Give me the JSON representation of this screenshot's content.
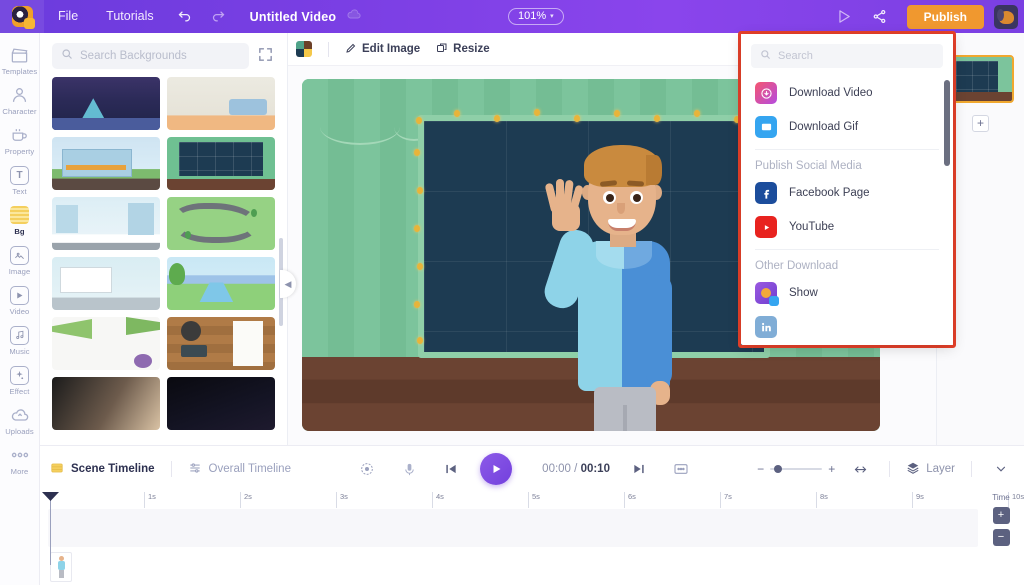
{
  "topbar": {
    "logo_icon": "animaker-logo-icon",
    "menus": [
      "File",
      "Tutorials"
    ],
    "undo_icon": "undo-icon",
    "redo_icon": "redo-icon",
    "doc_title": "Untitled Video",
    "cloud_icon": "cloud-save-icon",
    "zoom_level": "101%",
    "zoom_caret": "▾",
    "preview_icon": "preview-play-icon",
    "share_icon": "share-icon",
    "publish_label": "Publish",
    "avatar_icon": "user-avatar",
    "accent_purple": "#7b3fe4",
    "publish_orange": "#f0982f"
  },
  "rail": {
    "items": [
      {
        "label": "Templates",
        "icon": "templates-icon",
        "active": false
      },
      {
        "label": "Character",
        "icon": "character-icon",
        "active": false
      },
      {
        "label": "Property",
        "icon": "property-icon",
        "active": false
      },
      {
        "label": "Text",
        "icon": "text-icon",
        "active": false
      },
      {
        "label": "Bg",
        "icon": "background-icon",
        "active": true
      },
      {
        "label": "Image",
        "icon": "image-icon",
        "active": false
      },
      {
        "label": "Video",
        "icon": "video-icon",
        "active": false
      },
      {
        "label": "Music",
        "icon": "music-icon",
        "active": false
      },
      {
        "label": "Effect",
        "icon": "effect-icon",
        "active": false
      },
      {
        "label": "Uploads",
        "icon": "uploads-icon",
        "active": false
      },
      {
        "label": "More",
        "icon": "more-icon",
        "active": false
      }
    ]
  },
  "bg_panel": {
    "search_placeholder": "Search Backgrounds",
    "search_value": "",
    "search_icon": "search-icon",
    "expand_icon": "expand-icon",
    "collapse_icon": "chevron-left-icon",
    "thumbnails": [
      {
        "name": "night-cave-scene"
      },
      {
        "name": "living-room-sofa-scene"
      },
      {
        "name": "office-building-exterior"
      },
      {
        "name": "classroom-chalkboard-scene"
      },
      {
        "name": "city-street-winter"
      },
      {
        "name": "winding-road-landscape"
      },
      {
        "name": "presentation-screen-room"
      },
      {
        "name": "river-mountain-landscape"
      },
      {
        "name": "palm-leaves-flatlay"
      },
      {
        "name": "wooden-desk-flatlay"
      },
      {
        "name": "blurred-warm-photo"
      },
      {
        "name": "dark-photo"
      }
    ]
  },
  "canvas": {
    "swatch_icon": "color-swatch-icon",
    "edit_image_label": "Edit Image",
    "edit_image_icon": "pencil-icon",
    "resize_label": "Resize",
    "resize_icon": "resize-icon",
    "scene_name": "classroom-chalkboard-scene",
    "character_name": "waving-boy-character"
  },
  "scenes_panel": {
    "selected_scene": "scene-1-classroom",
    "add_scene_label": "+",
    "selection_color": "#f0a82f"
  },
  "publish_dropdown": {
    "highlight_color": "#e8412a",
    "search_placeholder": "Search",
    "search_value": "",
    "search_icon": "search-icon",
    "items": [
      {
        "label": "Download Video",
        "icon": "download-video-icon"
      },
      {
        "label": "Download Gif",
        "icon": "download-gif-icon"
      }
    ],
    "section_social": "Publish Social Media",
    "social_items": [
      {
        "label": "Facebook Page",
        "icon": "facebook-icon"
      },
      {
        "label": "YouTube",
        "icon": "youtube-icon"
      }
    ],
    "section_other": "Other Download",
    "other_items": [
      {
        "label": "Show",
        "icon": "show-app-icon"
      },
      {
        "label": "",
        "icon": "linkedin-icon"
      }
    ]
  },
  "timeline": {
    "scene_tab": "Scene Timeline",
    "scene_tab_icon": "scene-timeline-icon",
    "overall_tab": "Overall Timeline",
    "overall_tab_icon": "overall-timeline-icon",
    "transition_icon": "transition-icon",
    "mic_icon": "microphone-icon",
    "prev_icon": "previous-scene-icon",
    "play_icon": "play-icon",
    "next_icon": "next-scene-icon",
    "caption_icon": "caption-icon",
    "current_time": "00:00",
    "time_separator": "/",
    "total_time": "00:10",
    "zoom_minus": "−",
    "zoom_plus": "+",
    "fit_icon": "fit-width-icon",
    "layer_label": "Layer",
    "layer_icon": "layers-icon",
    "collapse_icon": "chevron-down-icon",
    "ruler_ticks": [
      "1s",
      "2s",
      "3s",
      "4s",
      "5s",
      "6s",
      "7s",
      "8s",
      "9s",
      "10s"
    ],
    "time_label": "Time",
    "time_plus": "+",
    "time_minus": "−",
    "clip_name": "character-clip"
  }
}
